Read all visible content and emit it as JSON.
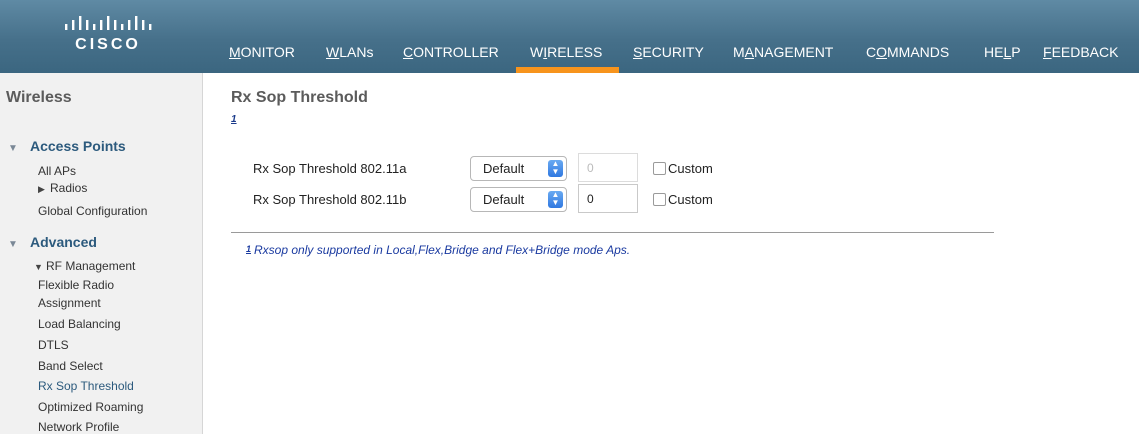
{
  "brand": {
    "logo_text": "CISCO"
  },
  "nav": {
    "items": [
      {
        "label": "MONITOR",
        "underline": "M",
        "rest": "ONITOR"
      },
      {
        "label": "WLANs",
        "underline": "W",
        "rest": "LANs"
      },
      {
        "label": "CONTROLLER",
        "underline": "C",
        "rest": "ONTROLLER"
      },
      {
        "label": "WIRELESS",
        "pre": "W",
        "underline": "I",
        "rest": "RELESS"
      },
      {
        "label": "SECURITY",
        "underline": "S",
        "rest": "ECURITY"
      },
      {
        "label": "MANAGEMENT",
        "pre": "M",
        "underline": "A",
        "rest": "NAGEMENT"
      },
      {
        "label": "COMMANDS",
        "pre": "C",
        "underline": "O",
        "rest": "MMANDS"
      },
      {
        "label": "HELP",
        "pre": "HE",
        "underline": "L",
        "rest": "P"
      },
      {
        "label": "FEEDBACK",
        "underline": "F",
        "rest": "EEDBACK"
      }
    ],
    "active": "WIRELESS",
    "active_color": "#f7941d"
  },
  "sidebar": {
    "title": "Wireless",
    "access_points": {
      "label": "Access Points",
      "items": [
        "All APs",
        "Radios",
        "Global Configuration"
      ]
    },
    "advanced": {
      "label": "Advanced",
      "rf_management": "RF Management",
      "items": [
        "Flexible Radio",
        "Assignment",
        "Load Balancing",
        "DTLS",
        "Band Select",
        "Rx Sop Threshold",
        "Optimized Roaming",
        "Network Profile"
      ],
      "active_item": "Rx Sop Threshold"
    }
  },
  "main": {
    "title": "Rx Sop Threshold",
    "title_footnote": "1",
    "rows": [
      {
        "label": "Rx Sop Threshold 802.11a",
        "select_value": "Default",
        "input_value": "0",
        "input_disabled": true,
        "custom_label": "Custom",
        "custom_checked": false
      },
      {
        "label": "Rx Sop Threshold 802.11b",
        "select_value": "Default",
        "input_value": "0",
        "input_disabled": false,
        "custom_label": "Custom",
        "custom_checked": false
      }
    ],
    "footnote_mark": "1",
    "footnote_text": "Rxsop only supported in Local,Flex,Bridge and Flex+Bridge mode Aps."
  }
}
